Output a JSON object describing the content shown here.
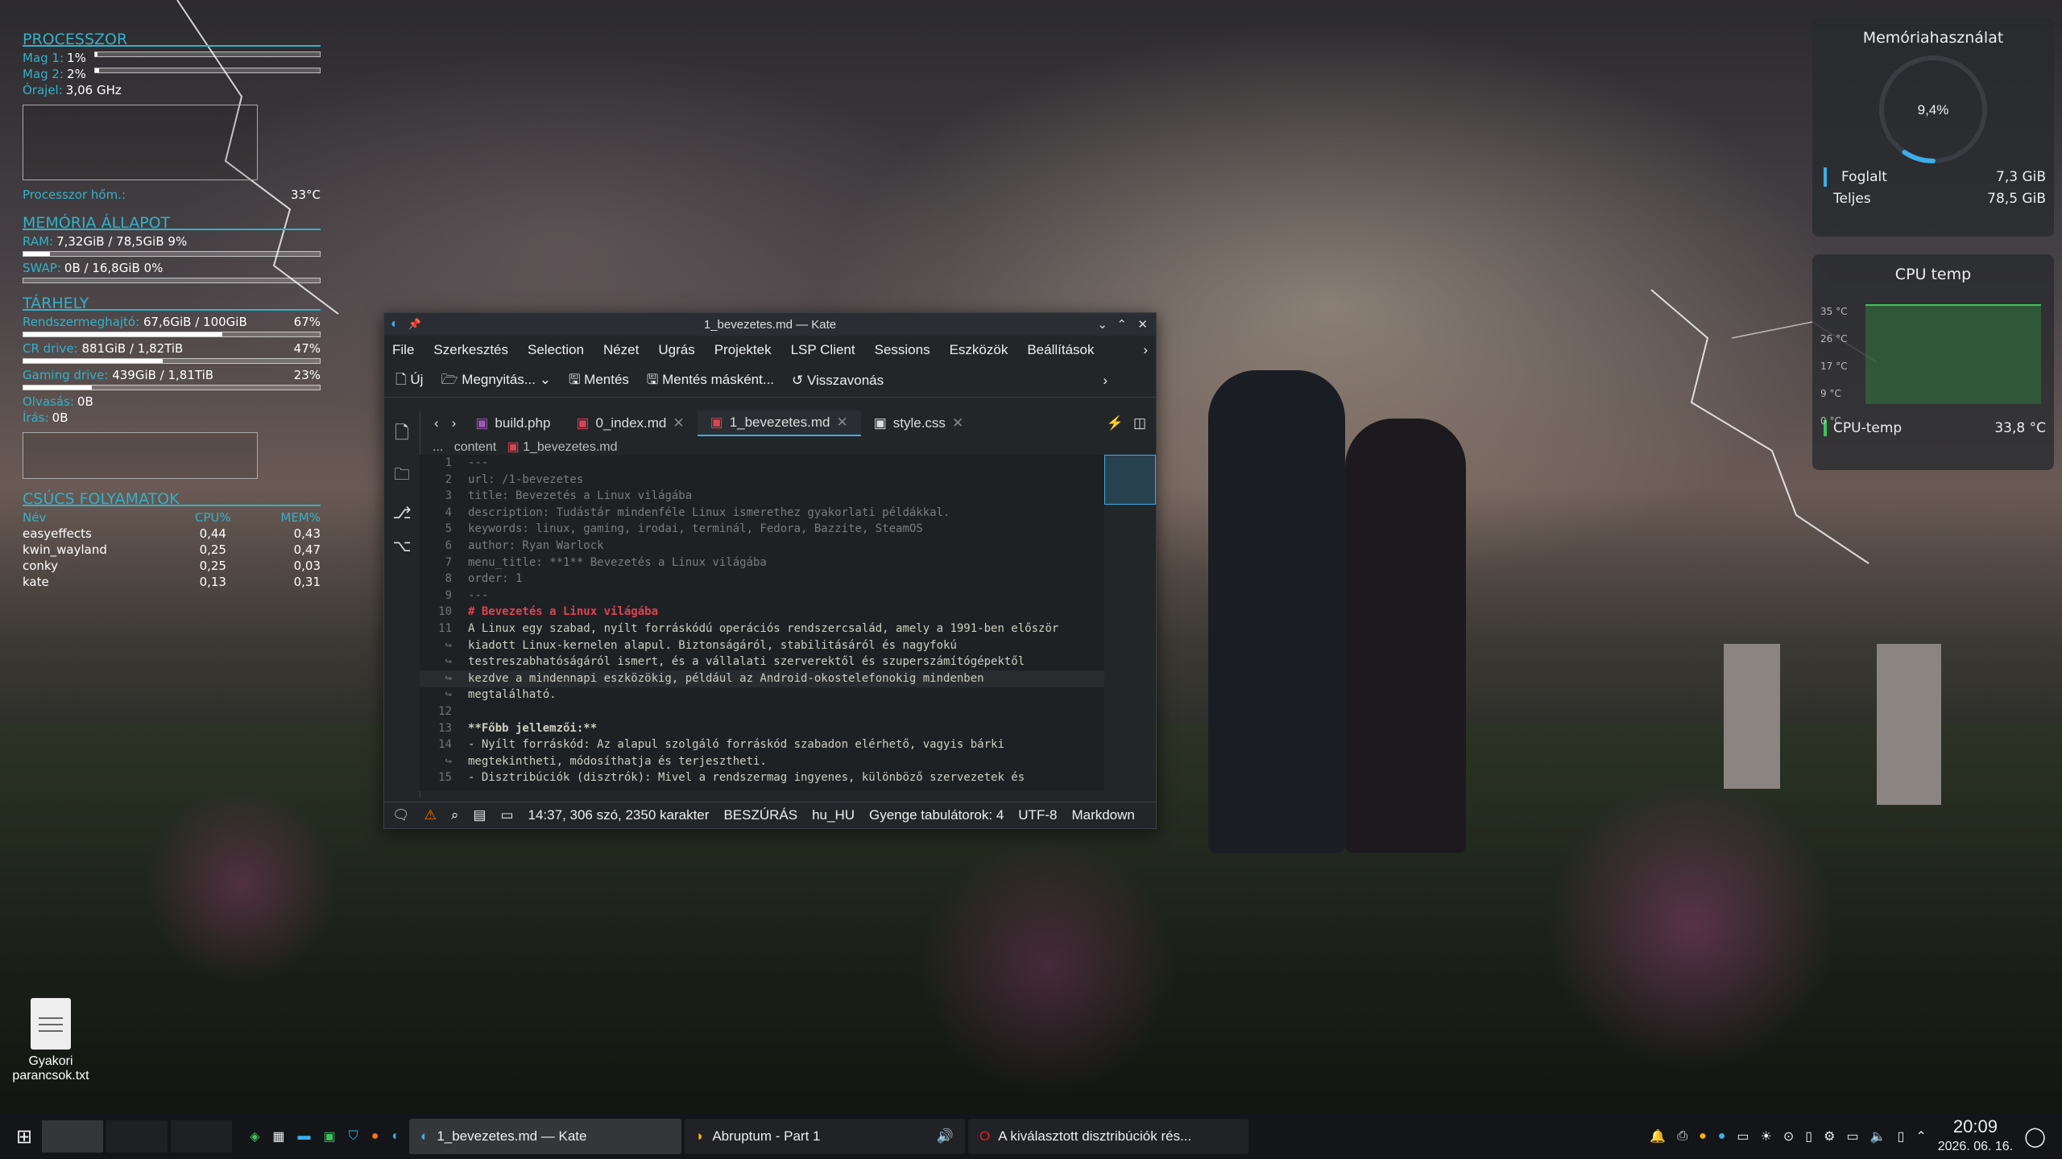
{
  "conky": {
    "cpu_title": "PROCESSZOR",
    "core1_label": "Mag 1:",
    "core1_value": "1%",
    "core1_pct": 1,
    "core2_label": "Mag 2:",
    "core2_value": "2%",
    "core2_pct": 2,
    "clock_label": "Órajel:",
    "clock_value": "3,06 GHz",
    "temp_label": "Processzor hőm.:",
    "temp_value": "33°C",
    "mem_title": "MEMÓRIA ÁLLAPOT",
    "ram_label": "RAM:",
    "ram_value": "7,32GiB / 78,5GiB 9%",
    "ram_pct": 9,
    "swap_label": "SWAP:",
    "swap_value": "0B / 16,8GiB 0%",
    "swap_pct": 0,
    "storage_title": "TÁRHELY",
    "disks": [
      {
        "label": "Rendszermeghajtó:",
        "value": "67,6GiB / 100GiB",
        "pct_text": "67%",
        "pct": 67
      },
      {
        "label": "CR drive:",
        "value": "881GiB / 1,82TiB",
        "pct_text": "47%",
        "pct": 47
      },
      {
        "label": "Gaming drive:",
        "value": "439GiB / 1,81TiB",
        "pct_text": "23%",
        "pct": 23
      }
    ],
    "read_label": "Olvasás:",
    "read_value": "0B",
    "write_label": "Írás:",
    "write_value": "0B",
    "proc_title": "CSÚCS FOLYAMATOK",
    "proc_headers": [
      "Név",
      "CPU%",
      "MEM%"
    ],
    "processes": [
      [
        "easyeffects",
        "0,44",
        "0,43"
      ],
      [
        "kwin_wayland",
        "0,25",
        "0,47"
      ],
      [
        "conky",
        "0,25",
        "0,03"
      ],
      [
        "kate",
        "0,13",
        "0,31"
      ]
    ]
  },
  "memory_widget": {
    "title": "Memóriahasználat",
    "percent_text": "9,4%",
    "percent": 9.4,
    "used_label": "Foglalt",
    "used_value": "7,3 GiB",
    "total_label": "Teljes",
    "total_value": "78,5 GiB"
  },
  "cpu_temp_widget": {
    "title": "CPU temp",
    "ticks": [
      "35 °C",
      "26 °C",
      "17 °C",
      "9 °C",
      "0 °C"
    ],
    "legend_label": "CPU-temp",
    "legend_value": "33,8 °C"
  },
  "kate": {
    "title": "1_bevezetes.md — Kate",
    "menu": [
      "File",
      "Szerkesztés",
      "Selection",
      "Nézet",
      "Ugrás",
      "Projektek",
      "LSP Client",
      "Sessions",
      "Eszközök",
      "Beállítások"
    ],
    "toolbar": {
      "new": "Új",
      "open": "Megnyitás...",
      "save": "Mentés",
      "save_as": "Mentés másként...",
      "revert": "Visszavonás"
    },
    "tabs": [
      {
        "label": "build.php",
        "active": false
      },
      {
        "label": "0_index.md",
        "active": false
      },
      {
        "label": "1_bevezetes.md",
        "active": true
      },
      {
        "label": "style.css",
        "active": false
      }
    ],
    "breadcrumb": {
      "ellipsis": "...",
      "folder": "content",
      "file": "1_bevezetes.md"
    },
    "line_numbers": [
      "1",
      "2",
      "3",
      "4",
      "5",
      "6",
      "7",
      "8",
      "9",
      "10",
      "11",
      "↪",
      "↪",
      "↪",
      "↪",
      "12",
      "13",
      "14",
      "↪",
      "15"
    ],
    "code_lines": [
      "---",
      "url: /1-bevezetes",
      "title: Bevezetés a Linux világába",
      "description: Tudástár mindenféle Linux ismerethez gyakorlati példákkal.",
      "keywords: linux, gaming, irodai, terminál, Fedora, Bazzite, SteamOS",
      "author: Ryan Warlock",
      "menu_title: **1** Bevezetés a Linux világába",
      "order: 1",
      "---",
      "# Bevezetés a Linux világába",
      "A Linux egy szabad, nyílt forráskódú operációs rendszercsalád, amely a 1991-ben először",
      "kiadott Linux-kernelen alapul. Biztonságáról, stabilitásáról és nagyfokú",
      "testreszabhatóságáról ismert, és a vállalati szerverektől és szuperszámítógépektől",
      "kezdve a mindennapi eszközökig, például az Android-okostelefonokig mindenben",
      "megtalálható.",
      "",
      "**Főbb jellemzői:**",
      "- Nyílt forráskód: Az alapul szolgáló forráskód szabadon elérhető, vagyis bárki",
      "megtekintheti, módosíthatja és terjesztheti.",
      "- Disztribúciók (disztrók): Mivel a rendszermag ingyenes, különböző szervezetek és"
    ],
    "status": {
      "position": "14:37, 306 szó, 2350 karakter",
      "mode": "BESZÚRÁS",
      "lang": "hu_HU",
      "tabs": "Gyenge tabulátorok: 4",
      "encoding": "UTF-8",
      "syntax": "Markdown"
    }
  },
  "desktop_icon": {
    "label": "Gyakori parancsok.txt"
  },
  "taskbar": {
    "tasks": [
      {
        "label": "1_bevezetes.md — Kate"
      },
      {
        "label": "Abruptum - Part 1"
      },
      {
        "label": "A kiválasztott disztribúciók rés..."
      }
    ],
    "time": "20:09",
    "date": "2026. 06. 16."
  },
  "colors": {
    "accent": "#3daee9",
    "conky": "#34b1c8",
    "heading": "#da4453"
  }
}
